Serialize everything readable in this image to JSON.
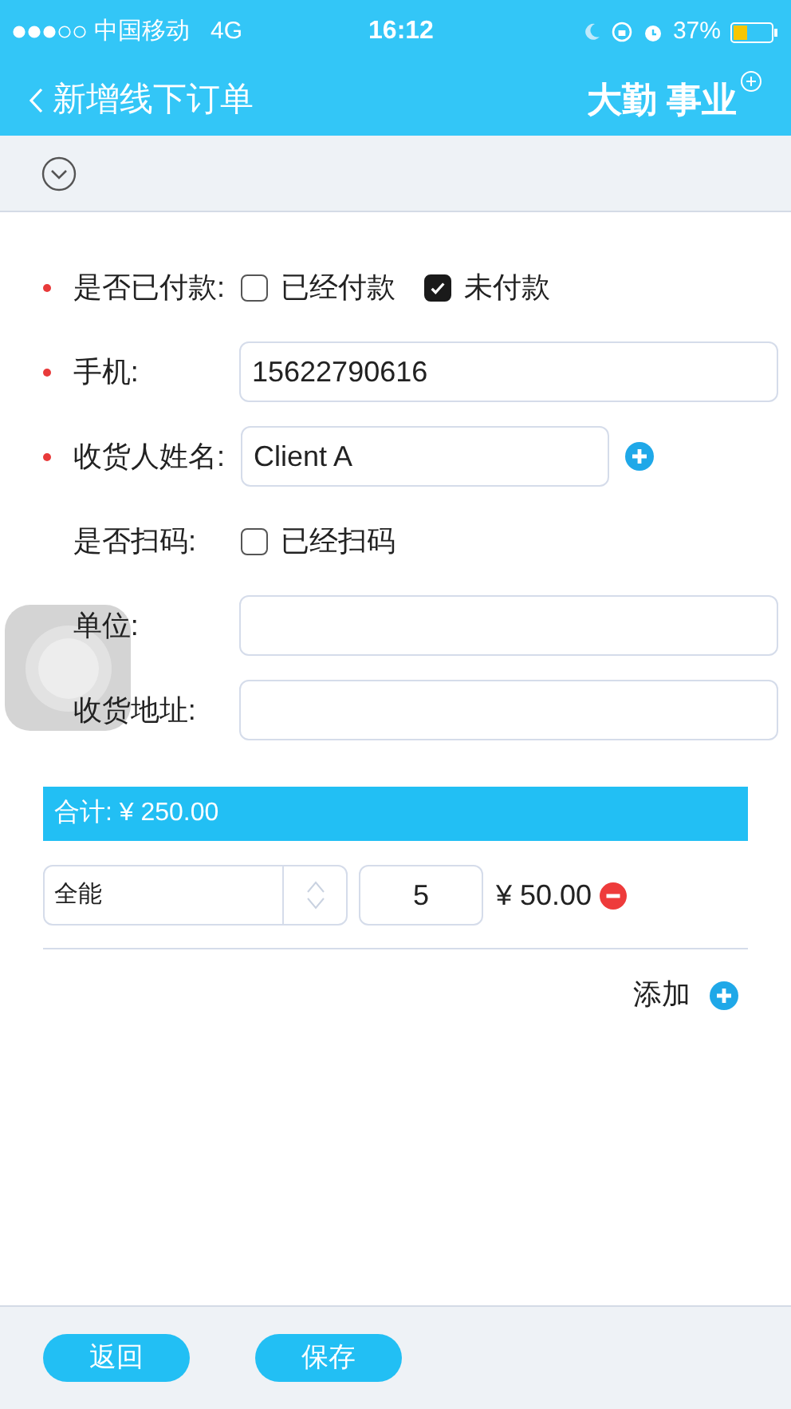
{
  "status_bar": {
    "carrier": "中国移动",
    "network": "4G",
    "time": "16:12",
    "battery": "37%"
  },
  "nav": {
    "title": "新增线下订单",
    "brand": "大勤 事业"
  },
  "form": [
    {
      "kind": "checkboxes",
      "label": "是否已付款:",
      "required": true,
      "options": [
        {
          "label": "已经付款",
          "checked": false
        },
        {
          "label": "未付款",
          "checked": true
        }
      ]
    },
    {
      "kind": "input",
      "label": "手机:",
      "required": true,
      "value": "15622790616"
    },
    {
      "kind": "input_add",
      "label": "收货人姓名:",
      "required": true,
      "value": "Client A"
    },
    {
      "kind": "checkboxes",
      "label": "是否扫码:",
      "required": false,
      "options": [
        {
          "label": "已经扫码",
          "checked": false
        }
      ]
    },
    {
      "kind": "input",
      "label": "单位:",
      "required": false
    },
    {
      "kind": "input",
      "label": "收货地址:",
      "required": false
    }
  ],
  "total": "合计: ¥ 250.00",
  "items": [
    {
      "product": "全能",
      "quantity": "5",
      "price": "¥ 50.00"
    }
  ],
  "add_label": "添加",
  "buttons": [
    "返回",
    "保存"
  ]
}
